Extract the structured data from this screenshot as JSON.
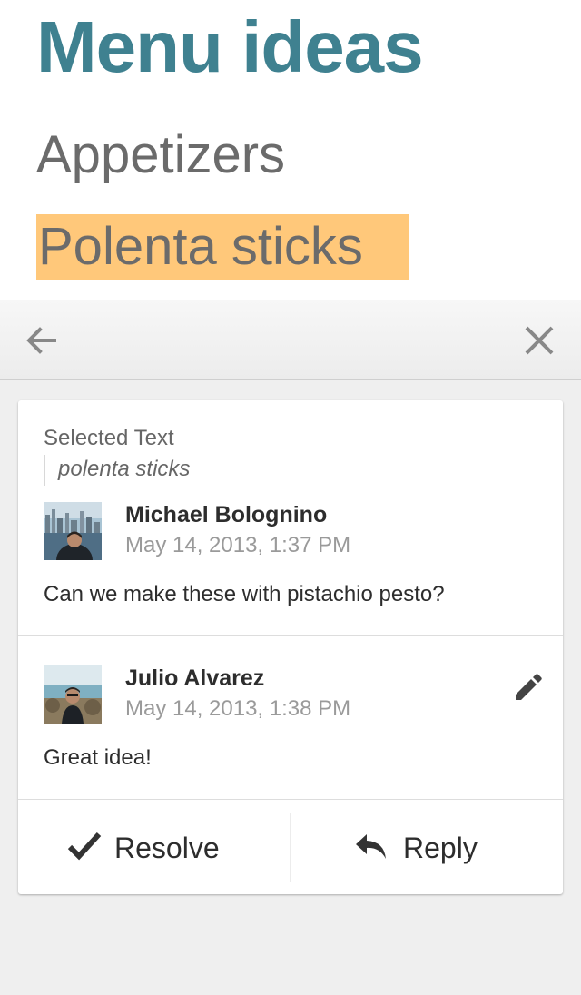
{
  "document": {
    "title": "Menu ideas",
    "heading": "Appetizers",
    "highlighted_text": "Polenta sticks",
    "colors": {
      "title": "#3f8190",
      "highlight": "#ffc87a"
    }
  },
  "toolbar": {
    "back_icon": "arrow-left-icon",
    "close_icon": "close-icon"
  },
  "comment_thread": {
    "selected_label": "Selected Text",
    "selected_quote": "polenta sticks",
    "comments": [
      {
        "author": "Michael Bolognino",
        "date": "May 14, 2013, 1:37 PM",
        "text": "Can we make these with pistachio pesto?",
        "avatar": "avatar-photo-city-skyline"
      },
      {
        "author": "Julio Alvarez",
        "date": "May 14, 2013, 1:38 PM",
        "text": "Great idea!",
        "avatar": "avatar-photo-beach",
        "edit_icon": "pencil-icon"
      }
    ],
    "actions": {
      "resolve_label": "Resolve",
      "resolve_icon": "checkmark-icon",
      "reply_label": "Reply",
      "reply_icon": "reply-arrow-icon"
    }
  }
}
